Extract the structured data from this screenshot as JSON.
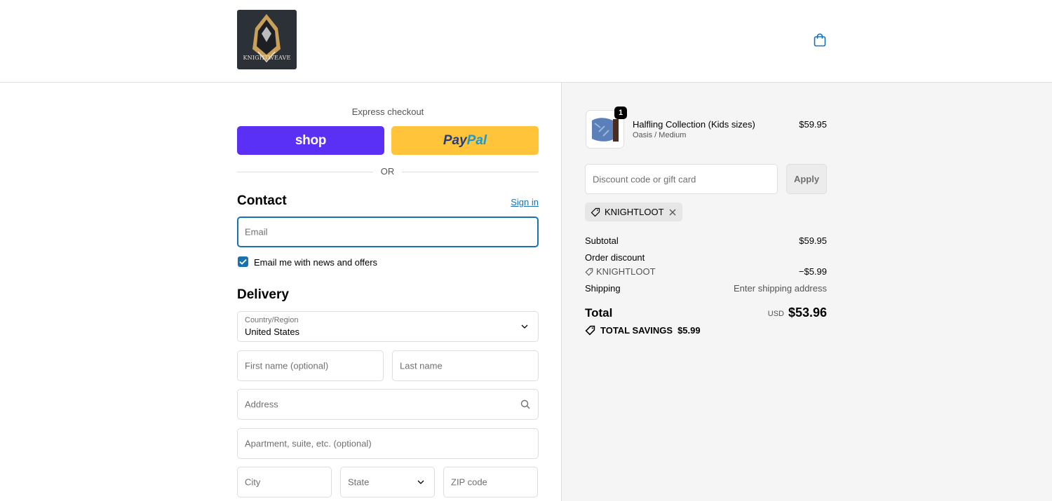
{
  "header": {
    "logo_text": "KNIGHTWEAVE",
    "cart_icon": "shopping-bag-icon"
  },
  "express": {
    "label": "Express checkout",
    "shop_label": "shop",
    "paypal_part1": "Pay",
    "paypal_part2": "Pal",
    "or_label": "OR"
  },
  "contact": {
    "heading": "Contact",
    "sign_in": "Sign in",
    "email_placeholder": "Email",
    "newsletter_label": "Email me with news and offers",
    "newsletter_checked": true
  },
  "delivery": {
    "heading": "Delivery",
    "country_label": "Country/Region",
    "country_value": "United States",
    "first_name_placeholder": "First name (optional)",
    "last_name_placeholder": "Last name",
    "address_placeholder": "Address",
    "apartment_placeholder": "Apartment, suite, etc. (optional)",
    "city_placeholder": "City",
    "state_placeholder": "State",
    "zip_placeholder": "ZIP code"
  },
  "order": {
    "item": {
      "quantity": "1",
      "name": "Halfling Collection (Kids sizes)",
      "variant": "Oasis / Medium",
      "price": "$59.95"
    },
    "discount_placeholder": "Discount code or gift card",
    "apply_label": "Apply",
    "applied_code": "KNIGHTLOOT",
    "subtotal_label": "Subtotal",
    "subtotal_value": "$59.95",
    "order_discount_label": "Order discount",
    "discount_code": "KNIGHTLOOT",
    "discount_value": "−$5.99",
    "shipping_label": "Shipping",
    "shipping_value": "Enter shipping address",
    "total_label": "Total",
    "total_currency": "USD",
    "total_value": "$53.96",
    "savings_label": "TOTAL SAVINGS",
    "savings_value": "$5.99"
  },
  "colors": {
    "accent": "#1773b0",
    "shop_pay": "#5a31f4",
    "paypal": "#ffc439"
  }
}
